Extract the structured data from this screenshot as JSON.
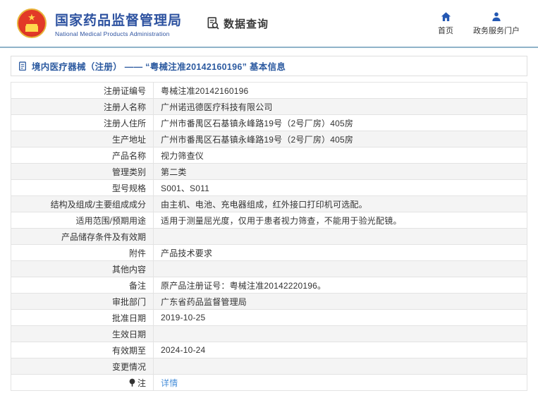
{
  "header": {
    "org_name_zh": "国家药品监督管理局",
    "org_name_en": "National Medical Products Administration",
    "query_label": "数据查询",
    "nav": [
      {
        "label": "首页",
        "icon": "home-icon"
      },
      {
        "label": "政务服务门户",
        "icon": "user-icon"
      }
    ]
  },
  "breadcrumb": {
    "text": "境内医疗器械（注册） —— “粤械注准20142160196” 基本信息"
  },
  "colors": {
    "brand_blue": "#2d52a0",
    "nav_icon_blue": "#2458b3",
    "link_blue": "#4a90d9",
    "rule_blue": "#8fb3c9",
    "row_alt_gray": "#f4f4f4"
  },
  "table": {
    "rows": [
      {
        "label": "注册证编号",
        "value": "粤械注准20142160196"
      },
      {
        "label": "注册人名称",
        "value": "广州诺迅德医疗科技有限公司"
      },
      {
        "label": "注册人住所",
        "value": "广州市番禺区石基镇永峰路19号（2号厂房）405房"
      },
      {
        "label": "生产地址",
        "value": "广州市番禺区石基镇永峰路19号（2号厂房）405房"
      },
      {
        "label": "产品名称",
        "value": "视力筛查仪"
      },
      {
        "label": "管理类别",
        "value": "第二类"
      },
      {
        "label": "型号规格",
        "value": "S001、S011"
      },
      {
        "label": "结构及组成/主要组成成分",
        "value": "由主机、电池、充电器组成，红外接口打印机可选配。"
      },
      {
        "label": "适用范围/预期用途",
        "value": "适用于测量屈光度，仅用于患者视力筛查，不能用于验光配镜。"
      },
      {
        "label": "产品储存条件及有效期",
        "value": ""
      },
      {
        "label": "附件",
        "value": "产品技术要求"
      },
      {
        "label": "其他内容",
        "value": ""
      },
      {
        "label": "备注",
        "value": "原产品注册证号：粤械注准20142220196。"
      },
      {
        "label": "审批部门",
        "value": "广东省药品监督管理局"
      },
      {
        "label": "批准日期",
        "value": "2019-10-25"
      },
      {
        "label": "生效日期",
        "value": ""
      },
      {
        "label": "有效期至",
        "value": "2024-10-24"
      },
      {
        "label": "变更情况",
        "value": ""
      },
      {
        "label": "注",
        "value": "详情",
        "link": true,
        "label_icon": "note-icon"
      }
    ]
  }
}
